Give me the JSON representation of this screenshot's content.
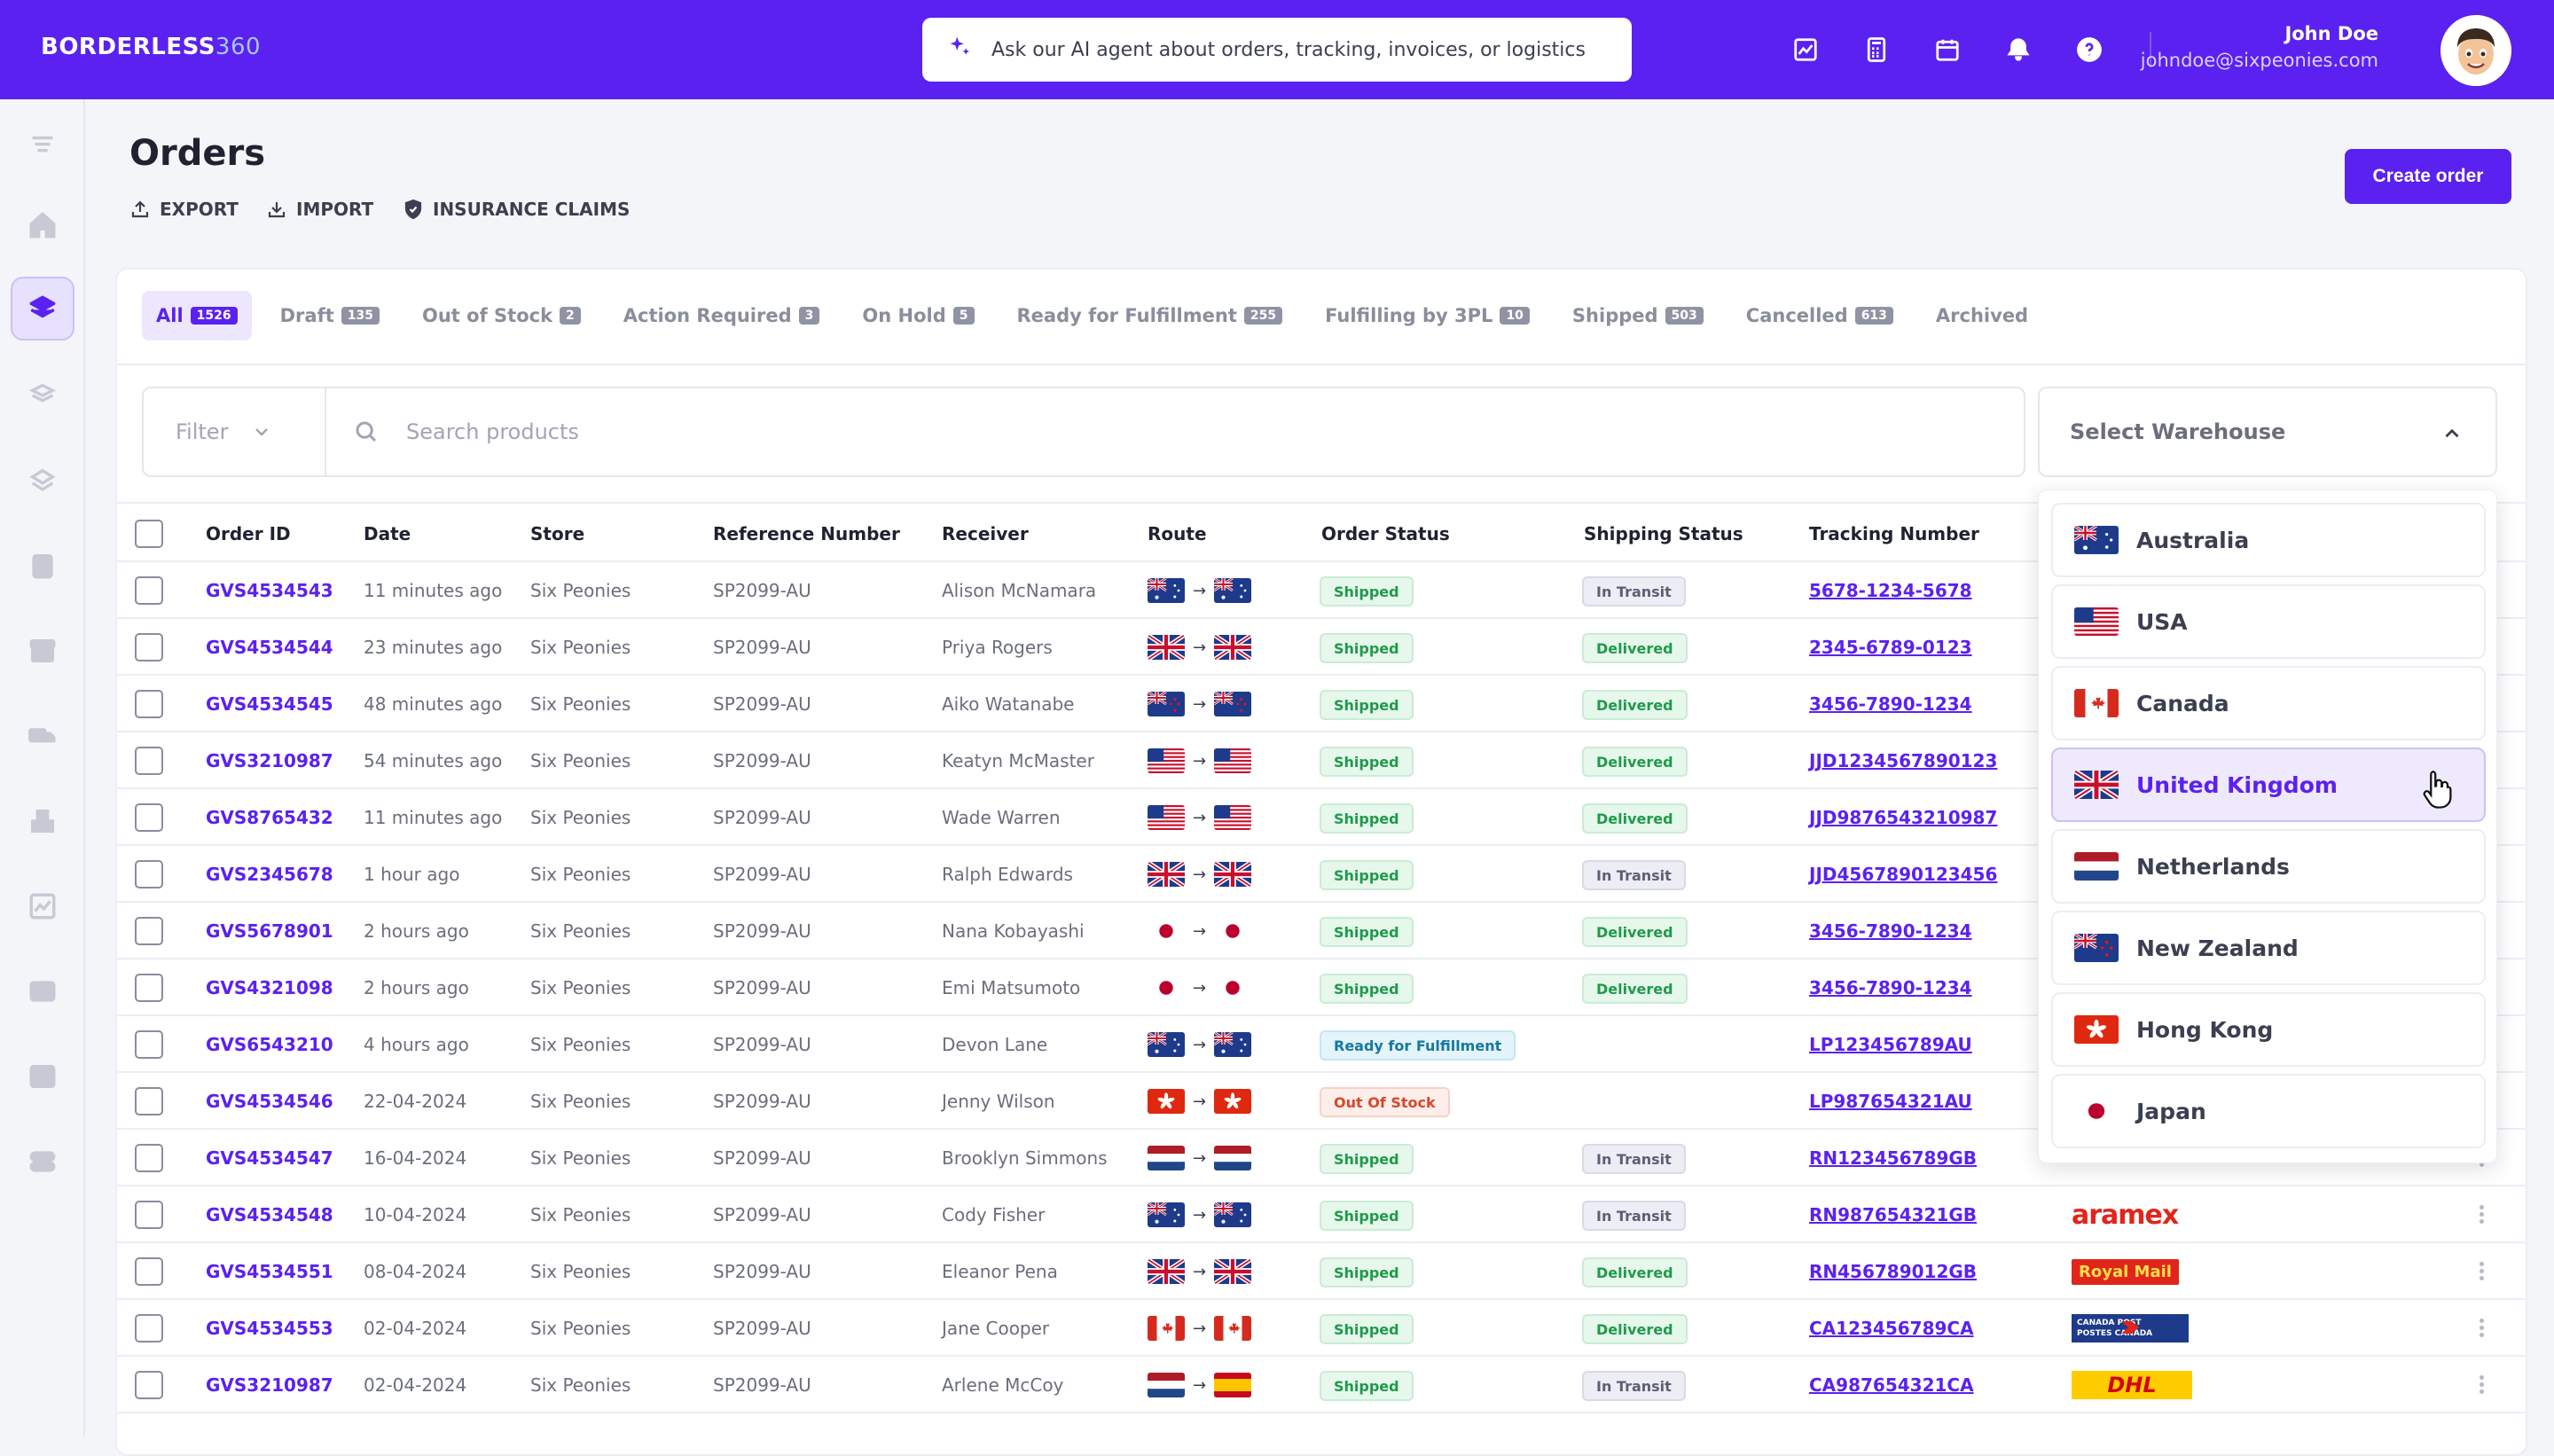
{
  "app": {
    "logo_bold": "BORDERLESS",
    "logo_num": "360"
  },
  "header": {
    "ai_placeholder": "Ask our AI agent about orders, tracking, invoices, or logistics",
    "user_name": "John Doe",
    "user_email": "johndoe@sixpeonies.com"
  },
  "page": {
    "title": "Orders",
    "export": "EXPORT",
    "import": "IMPORT",
    "claims": "INSURANCE CLAIMS",
    "create": "Create order"
  },
  "tabs": [
    {
      "label": "All",
      "count": "1526"
    },
    {
      "label": "Draft",
      "count": "135"
    },
    {
      "label": "Out of Stock",
      "count": "2"
    },
    {
      "label": "Action Required",
      "count": "3"
    },
    {
      "label": "On Hold",
      "count": "5"
    },
    {
      "label": "Ready for Fulfillment",
      "count": "255"
    },
    {
      "label": "Fulfilling by 3PL",
      "count": "10"
    },
    {
      "label": "Shipped",
      "count": "503"
    },
    {
      "label": "Cancelled",
      "count": "613"
    },
    {
      "label": "Archived",
      "count": ""
    }
  ],
  "filters": {
    "filter_label": "Filter",
    "search_placeholder": "Search products",
    "warehouse_label": "Select Warehouse"
  },
  "columns": [
    "Order ID",
    "Date",
    "Store",
    "Reference Number",
    "Receiver",
    "Route",
    "Order Status",
    "Shipping Status",
    "Tracking Number"
  ],
  "rows": [
    {
      "id": "GVS4534543",
      "date": "11 minutes ago",
      "store": "Six Peonies",
      "ref": "SP2099-AU",
      "receiver": "Alison McNamara",
      "flag": "au",
      "status": "Shipped",
      "ship": "In Transit",
      "tracking": "5678-1234-5678",
      "carrier": ""
    },
    {
      "id": "GVS4534544",
      "date": "23 minutes ago",
      "store": "Six Peonies",
      "ref": "SP2099-AU",
      "receiver": "Priya Rogers",
      "flag": "uk",
      "status": "Shipped",
      "ship": "Delivered",
      "tracking": "2345-6789-0123",
      "carrier": ""
    },
    {
      "id": "GVS4534545",
      "date": "48 minutes ago",
      "store": "Six Peonies",
      "ref": "SP2099-AU",
      "receiver": "Aiko Watanabe",
      "flag": "nz",
      "status": "Shipped",
      "ship": "Delivered",
      "tracking": "3456-7890-1234",
      "carrier": ""
    },
    {
      "id": "GVS3210987",
      "date": "54 minutes ago",
      "store": "Six Peonies",
      "ref": "SP2099-AU",
      "receiver": "Keatyn McMaster",
      "flag": "us",
      "status": "Shipped",
      "ship": "Delivered",
      "tracking": "JJD1234567890123",
      "carrier": ""
    },
    {
      "id": "GVS8765432",
      "date": "11 minutes ago",
      "store": "Six Peonies",
      "ref": "SP2099-AU",
      "receiver": "Wade Warren",
      "flag": "us",
      "status": "Shipped",
      "ship": "Delivered",
      "tracking": "JJD9876543210987",
      "carrier": ""
    },
    {
      "id": "GVS2345678",
      "date": "1 hour ago",
      "store": "Six Peonies",
      "ref": "SP2099-AU",
      "receiver": "Ralph Edwards",
      "flag": "uk",
      "status": "Shipped",
      "ship": "In Transit",
      "tracking": "JJD4567890123456",
      "carrier": ""
    },
    {
      "id": "GVS5678901",
      "date": "2 hours ago",
      "store": "Six Peonies",
      "ref": "SP2099-AU",
      "receiver": "Nana Kobayashi",
      "flag": "jp",
      "status": "Shipped",
      "ship": "Delivered",
      "tracking": "3456-7890-1234",
      "carrier": ""
    },
    {
      "id": "GVS4321098",
      "date": "2 hours ago",
      "store": "Six Peonies",
      "ref": "SP2099-AU",
      "receiver": "Emi Matsumoto",
      "flag": "jp",
      "status": "Shipped",
      "ship": "Delivered",
      "tracking": "3456-7890-1234",
      "carrier": ""
    },
    {
      "id": "GVS6543210",
      "date": "4 hours ago",
      "store": "Six Peonies",
      "ref": "SP2099-AU",
      "receiver": "Devon Lane",
      "flag": "au",
      "status": "Ready for Fulfillment",
      "ship": "",
      "tracking": "LP123456789AU",
      "carrier": ""
    },
    {
      "id": "GVS4534546",
      "date": "22-04-2024",
      "store": "Six Peonies",
      "ref": "SP2099-AU",
      "receiver": "Jenny Wilson",
      "flag": "hk",
      "status": "Out Of Stock",
      "ship": "",
      "tracking": "LP987654321AU",
      "carrier": ""
    },
    {
      "id": "GVS4534547",
      "date": "16-04-2024",
      "store": "Six Peonies",
      "ref": "SP2099-AU",
      "receiver": "Brooklyn Simmons",
      "flag": "nl",
      "status": "Shipped",
      "ship": "In Transit",
      "tracking": "RN123456789GB",
      "carrier": ""
    },
    {
      "id": "GVS4534548",
      "date": "10-04-2024",
      "store": "Six Peonies",
      "ref": "SP2099-AU",
      "receiver": "Cody Fisher",
      "flag": "au",
      "status": "Shipped",
      "ship": "In Transit",
      "tracking": "RN987654321GB",
      "carrier": "aramex"
    },
    {
      "id": "GVS4534551",
      "date": "08-04-2024",
      "store": "Six Peonies",
      "ref": "SP2099-AU",
      "receiver": "Eleanor Pena",
      "flag": "uk",
      "status": "Shipped",
      "ship": "Delivered",
      "tracking": "RN456789012GB",
      "carrier": "royalmail"
    },
    {
      "id": "GVS4534553",
      "date": "02-04-2024",
      "store": "Six Peonies",
      "ref": "SP2099-AU",
      "receiver": "Jane Cooper",
      "flag": "ca",
      "status": "Shipped",
      "ship": "Delivered",
      "tracking": "CA123456789CA",
      "carrier": "canadapost"
    },
    {
      "id": "GVS3210987",
      "date": "02-04-2024",
      "store": "Six Peonies",
      "ref": "SP2099-AU",
      "receiver": "Arlene McCoy",
      "flag": "nl",
      "flag_to": "es",
      "status": "Shipped",
      "ship": "In Transit",
      "tracking": "CA987654321CA",
      "carrier": "dhl"
    }
  ],
  "carriers": {
    "aramex": "aramex",
    "royalmail": "Royal Mail",
    "canadapost_1": "CANADA POST",
    "canadapost_2": "POSTES CANADA",
    "dhl": "DHL"
  },
  "warehouses": [
    {
      "name": "Australia",
      "flag": "au"
    },
    {
      "name": "USA",
      "flag": "us"
    },
    {
      "name": "Canada",
      "flag": "ca"
    },
    {
      "name": "United Kingdom",
      "flag": "uk"
    },
    {
      "name": "Netherlands",
      "flag": "nl"
    },
    {
      "name": "New Zealand",
      "flag": "nz"
    },
    {
      "name": "Hong Kong",
      "flag": "hk"
    },
    {
      "name": "Japan",
      "flag": "jp"
    }
  ],
  "colors": {
    "brand": "#5b21f0",
    "delivered": "#1f9a4a",
    "out_of_stock": "#d6472b"
  }
}
